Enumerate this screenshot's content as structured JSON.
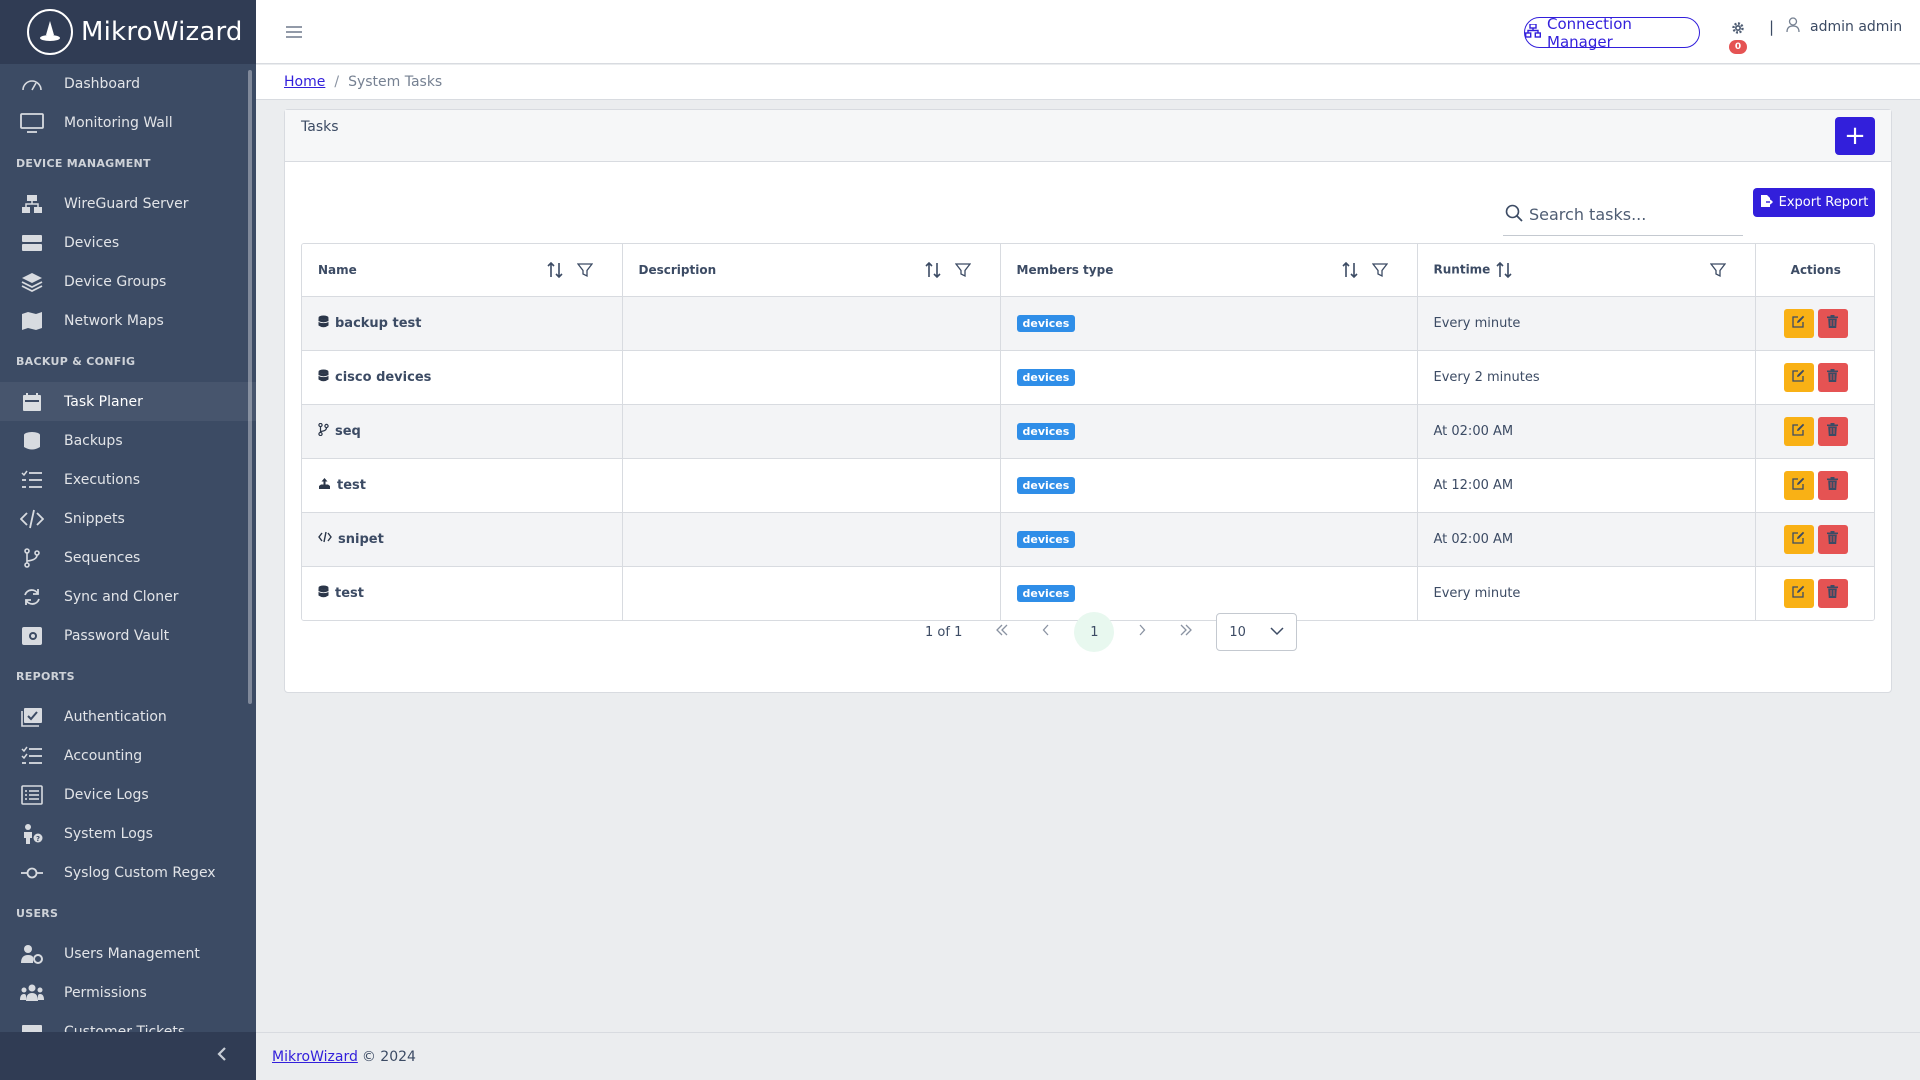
{
  "brand": {
    "name": "MikroWizard",
    "logo_icon": "wizard-hat-icon"
  },
  "sidebar": {
    "sections": [
      {
        "title": "",
        "items": [
          {
            "label": "Dashboard",
            "icon": "speedometer-icon"
          },
          {
            "label": "Monitoring Wall",
            "icon": "monitor-icon"
          }
        ]
      },
      {
        "title": "DEVICE MANAGMENT",
        "items": [
          {
            "label": "WireGuard Server",
            "icon": "network-icon"
          },
          {
            "label": "Devices",
            "icon": "server-icon"
          },
          {
            "label": "Device Groups",
            "icon": "layers-icon"
          },
          {
            "label": "Network Maps",
            "icon": "map-icon"
          }
        ]
      },
      {
        "title": "BACKUP & CONFIG",
        "items": [
          {
            "label": "Task Planer",
            "icon": "calendar-icon",
            "active": true
          },
          {
            "label": "Backups",
            "icon": "database-icon"
          },
          {
            "label": "Executions",
            "icon": "list-check-icon"
          },
          {
            "label": "Snippets",
            "icon": "code-icon"
          },
          {
            "label": "Sequences",
            "icon": "branch-icon"
          },
          {
            "label": "Sync and Cloner",
            "icon": "sync-icon"
          },
          {
            "label": "Password Vault",
            "icon": "vault-icon"
          }
        ]
      },
      {
        "title": "REPORTS",
        "items": [
          {
            "label": "Authentication",
            "icon": "chart-check-icon"
          },
          {
            "label": "Accounting",
            "icon": "list-check-icon"
          },
          {
            "label": "Device Logs",
            "icon": "list-rich-icon"
          },
          {
            "label": "System Logs",
            "icon": "person-question-icon"
          },
          {
            "label": "Syslog Custom Regex",
            "icon": "commit-icon"
          }
        ]
      },
      {
        "title": "USERS",
        "items": [
          {
            "label": "Users Management",
            "icon": "user-gear-icon"
          },
          {
            "label": "Permissions",
            "icon": "people-icon"
          },
          {
            "label": "Customer Tickets",
            "icon": "ticket-icon"
          }
        ]
      }
    ],
    "collapse_icon": "chevron-left-icon"
  },
  "header": {
    "connection_manager_label": "Connection Manager",
    "notification_count": "0",
    "separator": "|",
    "user_name": "admin admin"
  },
  "breadcrumb": {
    "home": "Home",
    "separator": "/",
    "current": "System Tasks"
  },
  "card": {
    "title": "Tasks",
    "add_label": "+",
    "search_placeholder": "Search tasks...",
    "export_label": "Export Report"
  },
  "table": {
    "columns": [
      "Name",
      "Description",
      "Members type",
      "Runtime",
      "Actions"
    ],
    "rows": [
      {
        "icon": "database-icon",
        "name": "backup test",
        "description": "",
        "members": "devices",
        "runtime": "Every minute"
      },
      {
        "icon": "database-icon",
        "name": "cisco devices",
        "description": "",
        "members": "devices",
        "runtime": "Every 2 minutes"
      },
      {
        "icon": "branch-icon",
        "name": "seq",
        "description": "",
        "members": "devices",
        "runtime": "At 02:00 AM"
      },
      {
        "icon": "firmware-upload-icon",
        "name": "test",
        "description": "",
        "members": "devices",
        "runtime": "At 12:00 AM"
      },
      {
        "icon": "code-icon",
        "name": "snipet",
        "description": "",
        "members": "devices",
        "runtime": "At 02:00 AM"
      },
      {
        "icon": "database-icon",
        "name": "test",
        "description": "",
        "members": "devices",
        "runtime": "Every minute"
      }
    ]
  },
  "pagination": {
    "info": "1 of 1",
    "current_page": "1",
    "page_size": "10"
  },
  "footer": {
    "link": "MikroWizard",
    "text": "© 2024"
  },
  "colors": {
    "primary": "#321fdb",
    "sidebar": "#3c4b64",
    "warning": "#f9b115",
    "danger": "#e55353",
    "badge": "#2f8ee8"
  }
}
